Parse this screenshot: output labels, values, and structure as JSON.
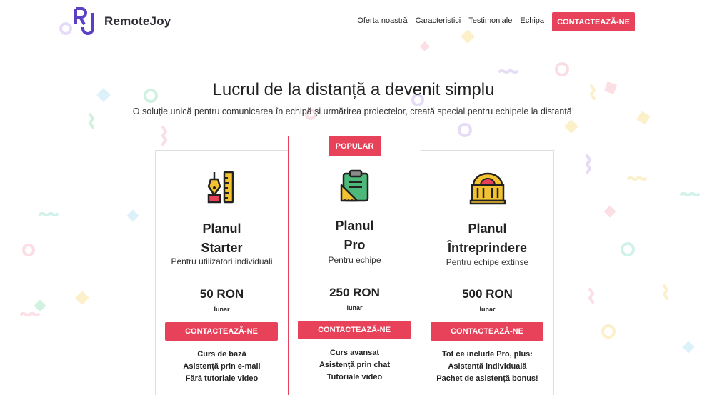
{
  "brand": {
    "name": "RemoteJoy",
    "logo_letters": "RJ"
  },
  "nav": {
    "items": [
      {
        "label": "Oferta noastră",
        "active": true
      },
      {
        "label": "Caracteristici",
        "active": false
      },
      {
        "label": "Testimoniale",
        "active": false
      },
      {
        "label": "Echipa",
        "active": false
      }
    ],
    "cta": "CONTACTEAZĂ-NE"
  },
  "hero": {
    "title": "Lucrul de la distanță a devenit simplu",
    "subtitle": "O soluție unică pentru comunicarea în echipă și urmărirea proiectelor, creată special pentru echipele la distanță!"
  },
  "plans": [
    {
      "icon": "pen-ruler-icon",
      "name_line1": "Planul",
      "name_line2": "Starter",
      "for": "Pentru utilizatori individuali",
      "price": "50 RON",
      "period": "lunar",
      "cta": "CONTACTEAZĂ-NE",
      "features": [
        "Curs de bază",
        "Asistență prin e-mail",
        "Fără tutoriale video"
      ]
    },
    {
      "badge": "POPULAR",
      "icon": "clipboard-ruler-icon",
      "name_line1": "Planul",
      "name_line2": "Pro",
      "for": "Pentru echipe",
      "price": "250 RON",
      "period": "lunar",
      "cta": "CONTACTEAZĂ-NE",
      "features": [
        "Curs avansat",
        "Asistență prin chat",
        "Tutoriale video"
      ]
    },
    {
      "icon": "building-icon",
      "name_line1": "Planul",
      "name_line2": "Întreprindere",
      "for": "Pentru echipe extinse",
      "price": "500 RON",
      "period": "lunar",
      "cta": "CONTACTEAZĂ-NE",
      "features": [
        "Tot ce include Pro, plus:",
        "Asistență individuală",
        "Pachet de asistență bonus!"
      ]
    }
  ],
  "colors": {
    "accent": "#e8425a",
    "logo": "#5b3fc4"
  }
}
